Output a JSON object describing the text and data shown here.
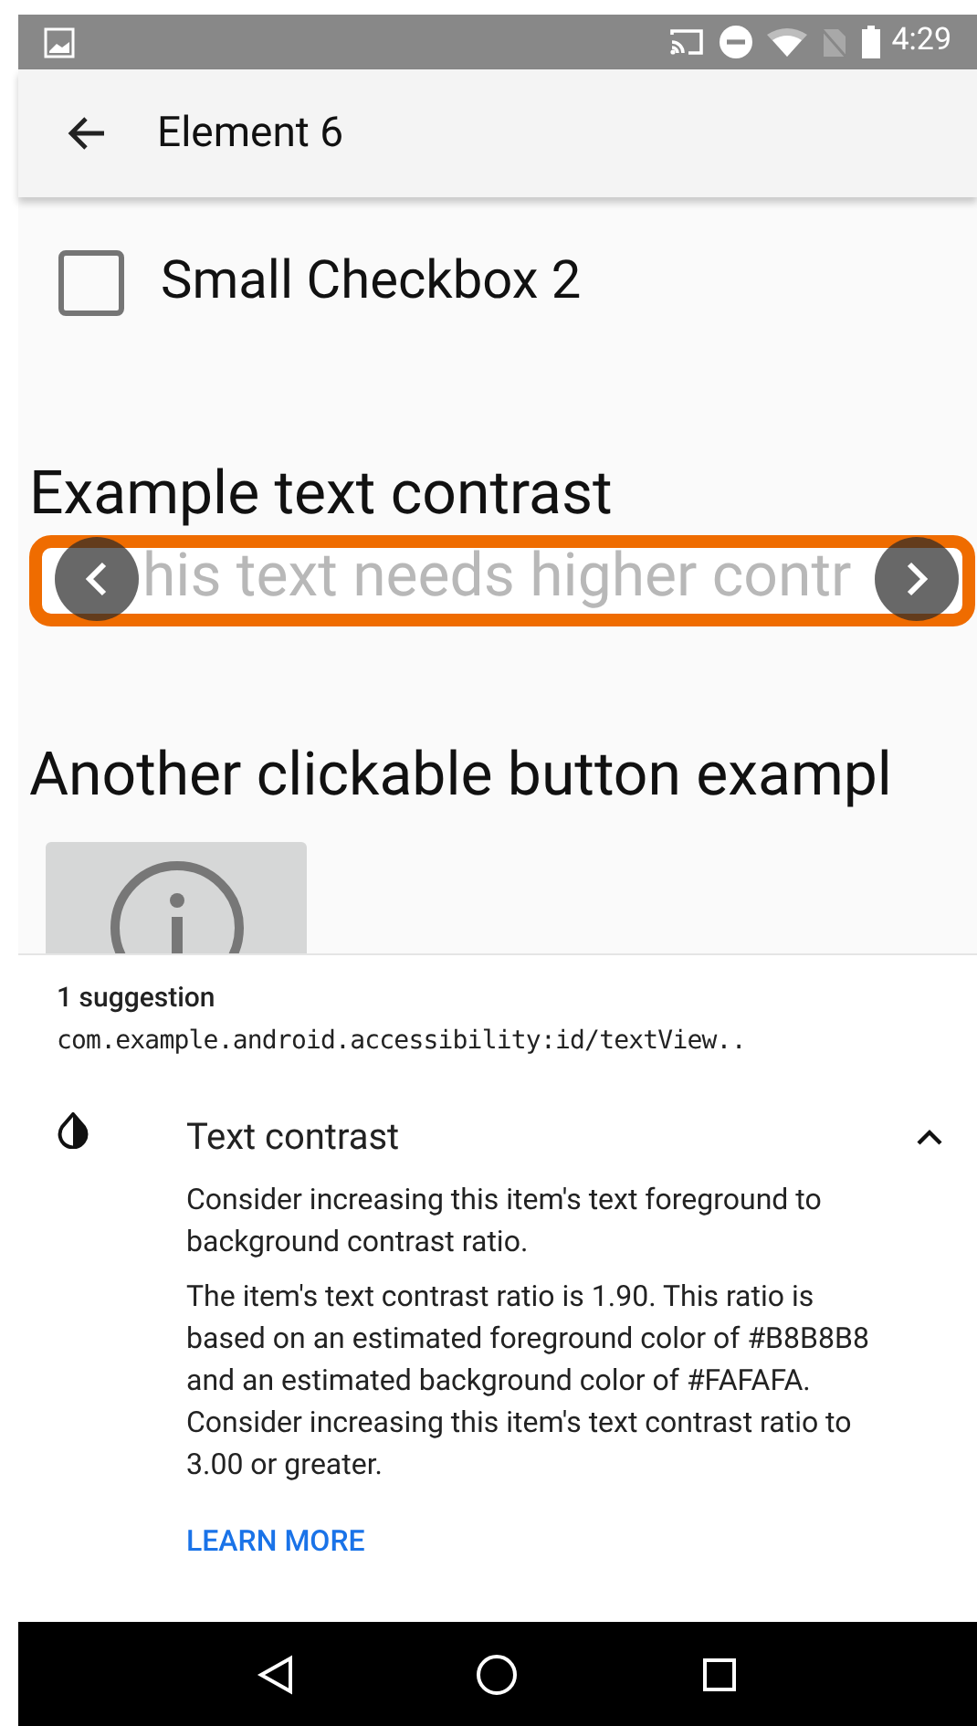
{
  "status_bar": {
    "time": "4:29"
  },
  "app_bar": {
    "title": "Element 6"
  },
  "checkbox": {
    "label": "Small Checkbox 2",
    "checked": false
  },
  "contrast_section": {
    "heading": "Example text contrast",
    "sample_text": "his text needs higher contr",
    "highlighted": true
  },
  "button_section": {
    "heading": "Another clickable button exampl"
  },
  "suggestions": {
    "count": "1 suggestion",
    "element_id": "com.example.android.accessibility:id/textView..",
    "items": [
      {
        "title": "Text contrast",
        "expanded": true,
        "summary": "Consider increasing this item's text foreground to background contrast ratio.",
        "detail": "The item's text contrast ratio is 1.90. This ratio is based on an estimated foreground color of #B8B8B8 and an estimated background color of #FAFAFA. Consider increasing this item's text contrast ratio to 3.00 or greater.",
        "link": "LEARN MORE"
      }
    ]
  }
}
